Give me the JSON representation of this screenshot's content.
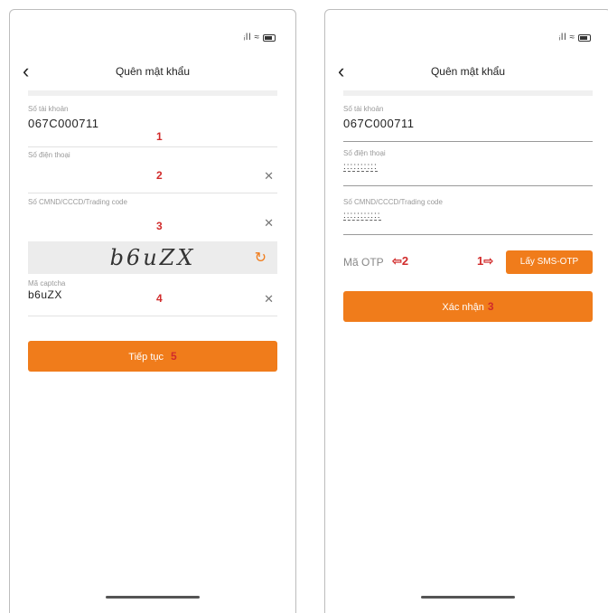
{
  "status_bar": {
    "signal": "ᵢll",
    "wifi": "⌔"
  },
  "left": {
    "title": "Quên mật khẩu",
    "account": {
      "label": "Số tài khoản",
      "value": "067C000711",
      "marker": "1"
    },
    "phone": {
      "label": "Số điện thoại",
      "marker": "2"
    },
    "id": {
      "label": "Số CMND/CCCD/Trading code",
      "marker": "3"
    },
    "captcha_image": "b6uZX",
    "captcha": {
      "label": "Mã captcha",
      "value": "b6uZX",
      "marker": "4"
    },
    "continue_button": {
      "label": "Tiếp tục",
      "marker": "5"
    }
  },
  "right": {
    "title": "Quên mật khẩu",
    "account": {
      "label": "Số tài khoản",
      "value": "067C000711"
    },
    "phone": {
      "label": "Số điện thoại",
      "value": "::::::::::"
    },
    "id": {
      "label": "Số CMND/CCCD/Trading code",
      "value": ":::::::::::"
    },
    "otp": {
      "label": "Mã OTP",
      "marker_label": "⇦2",
      "marker_btn": "1⇨",
      "button": "Lấy SMS-OTP"
    },
    "confirm_button": {
      "label": "Xác nhận",
      "marker": "3"
    }
  },
  "colors": {
    "accent": "#f07c1b",
    "marker": "#d12b2b"
  },
  "icons": {
    "back": "chevron-left-icon",
    "clear": "close-icon",
    "refresh": "refresh-icon"
  }
}
